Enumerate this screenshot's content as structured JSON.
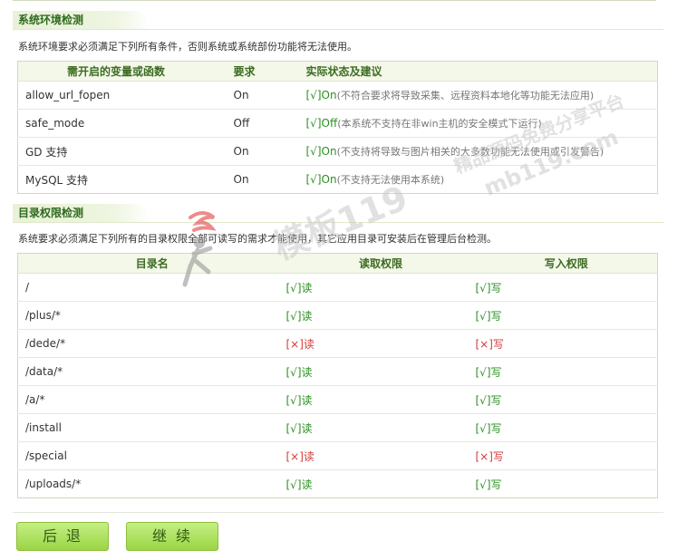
{
  "env_section": {
    "title": "系统环境检测",
    "note": "系统环境要求必须满足下列所有条件，否则系统或系统部份功能将无法使用。",
    "headers": [
      "需开启的变量或函数",
      "要求",
      "实际状态及建议"
    ],
    "rows": [
      {
        "name": "allow_url_fopen",
        "req": "On",
        "status": "[√]On",
        "hint": "(不符合要求将导致采集、远程资料本地化等功能无法应用)"
      },
      {
        "name": "safe_mode",
        "req": "Off",
        "status": "[√]Off",
        "hint": "(本系统不支持在非win主机的安全模式下运行)"
      },
      {
        "name": "GD 支持",
        "req": "On",
        "status": "[√]On",
        "hint": "(不支持将导致与图片相关的大多数功能无法使用或引发警告)"
      },
      {
        "name": "MySQL 支持",
        "req": "On",
        "status": "[√]On",
        "hint": "(不支持无法使用本系统)"
      }
    ]
  },
  "dir_section": {
    "title": "目录权限检测",
    "note": "系统要求必须满足下列所有的目录权限全部可读写的需求才能使用，其它应用目录可安装后在管理后台检测。",
    "headers": [
      "目录名",
      "读取权限",
      "写入权限"
    ],
    "rows": [
      {
        "dir": "/",
        "read": "[√]读",
        "read_ok": true,
        "write": "[√]写",
        "write_ok": true
      },
      {
        "dir": "/plus/*",
        "read": "[√]读",
        "read_ok": true,
        "write": "[√]写",
        "write_ok": true
      },
      {
        "dir": "/dede/*",
        "read": "[×]读",
        "read_ok": false,
        "write": "[×]写",
        "write_ok": false
      },
      {
        "dir": "/data/*",
        "read": "[√]读",
        "read_ok": true,
        "write": "[√]写",
        "write_ok": true
      },
      {
        "dir": "/a/*",
        "read": "[√]读",
        "read_ok": true,
        "write": "[√]写",
        "write_ok": true
      },
      {
        "dir": "/install",
        "read": "[√]读",
        "read_ok": true,
        "write": "[√]写",
        "write_ok": true
      },
      {
        "dir": "/special",
        "read": "[×]读",
        "read_ok": false,
        "write": "[×]写",
        "write_ok": false
      },
      {
        "dir": "/uploads/*",
        "read": "[√]读",
        "read_ok": true,
        "write": "[√]写",
        "write_ok": true
      }
    ]
  },
  "buttons": {
    "back": "后退",
    "continue": "继续"
  },
  "watermark": {
    "brand": "模板119",
    "tagline": "精品源码免费分享平台",
    "domain": "mb119.com"
  },
  "colors": {
    "ok": "#2a8f22",
    "bad": "#d23b3b",
    "accent": "#9ad544"
  }
}
